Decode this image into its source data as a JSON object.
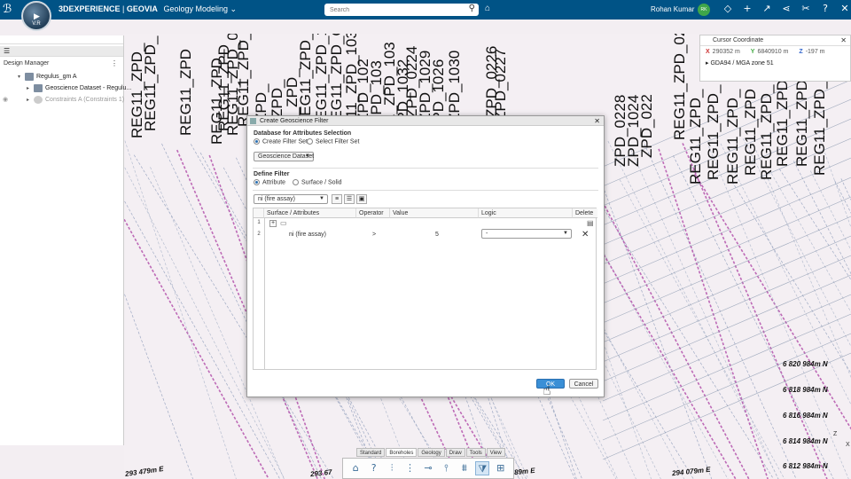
{
  "topbar": {
    "brand_platform": "3DEXPERIENCE",
    "brand_separator": "|",
    "brand_company": "GEOVIA",
    "app_name": "Geology Modeling",
    "app_chevron": "chevron-down-icon",
    "compass_version": "V.R",
    "search_placeholder": "Search",
    "user_name": "Rohan Kumar",
    "user_initials": "RK",
    "user_avatar_color": "#3fa64a",
    "bar_color": "#005386"
  },
  "left_panel": {
    "title": "Design Manager",
    "tree": [
      {
        "label": "Regulus_gm A",
        "icon": "product-icon",
        "dimmed": false
      },
      {
        "label": "Geoscience Dataset - Regulu...",
        "icon": "dataset-icon",
        "dimmed": false
      },
      {
        "label": "Constraints A (Constraints 1)",
        "icon": "constraint-icon",
        "dimmed": true
      }
    ]
  },
  "coord_panel": {
    "title": "Cursor Coordinate",
    "x_label": "X",
    "x_value": "290352 m",
    "y_label": "Y",
    "y_value": "6840910 m",
    "z_label": "Z",
    "z_value": "-197 m",
    "crs": "GDA94 / MGA zone 51"
  },
  "viewport": {
    "borehole_labels": [
      "REG11_ZPD_",
      "REG11_ZPD_",
      "REG11_ZPD",
      "REG11_ZPD_",
      "REG11_ZPD",
      "REG11_ZPD_02",
      "REG11_ZPD_03",
      "ZPD_",
      "ZPD_",
      "11_ZPD_",
      "REG11_ZPD_",
      "REG11_ZPD_10",
      "REG11_ZPD_O",
      "11_ZPD_103",
      "ZPD_102",
      "ZPD_103",
      "1_ZPD_103",
      "ZPD_1032",
      "ZPD_0224",
      "ZPD_1029",
      "ZPD_1026",
      "ZPD_1030",
      "ZPD_0226",
      "ZPD_0227",
      "ZPD_0228",
      "ZPD_1024",
      "ZPD_022",
      "REG11_ZPD_02",
      "REG11_ZPD_",
      "REG11_ZPD_",
      "REG11_ZPD_",
      "REG11_ZPD",
      "REG11_ZPD_",
      "REG11_ZPD_",
      "REG11_ZPD_",
      "REG11_ZPD_"
    ],
    "northing_labels": [
      "6 820 984m N",
      "6 818 984m N",
      "6 816 984m N",
      "6 814 984m N",
      "6 812 984m N"
    ],
    "easting_labels": [
      "293 479m E",
      "293 67",
      "89m E",
      "294 079m E"
    ],
    "axis_labels": [
      "Z",
      "X"
    ]
  },
  "dialog": {
    "title": "Create Geoscience Filter",
    "section_database": "Database for Attributes Selection",
    "radio_create": "Create Filter Set",
    "radio_select": "Select Filter Set",
    "database_value": "Geoscience Dataset",
    "section_define": "Define Filter",
    "radio_attribute": "Attribute",
    "radio_surface": "Surface / Solid",
    "attribute_value": "ni (fire assay)",
    "columns": [
      "Surface / Attributes",
      "Operator",
      "Value",
      "Logic",
      "Delete"
    ],
    "rows": [
      {
        "num": "1",
        "attribute": "",
        "operator": "",
        "value": "",
        "logic": ""
      },
      {
        "num": "2",
        "attribute": "ni (fire assay)",
        "operator": ">",
        "value": "5",
        "logic": "-"
      }
    ],
    "ok_label": "OK",
    "cancel_label": "Cancel"
  },
  "bottom_tabs": [
    "Standard",
    "Boreholes",
    "Geology",
    "Draw",
    "Tools",
    "View"
  ],
  "bottom_tools": [
    "home-icon",
    "help-icon",
    "borehole-icon",
    "log-icon",
    "section-icon",
    "drill-icon",
    "composite-icon",
    "filter-icon",
    "dataset-tool-icon"
  ]
}
